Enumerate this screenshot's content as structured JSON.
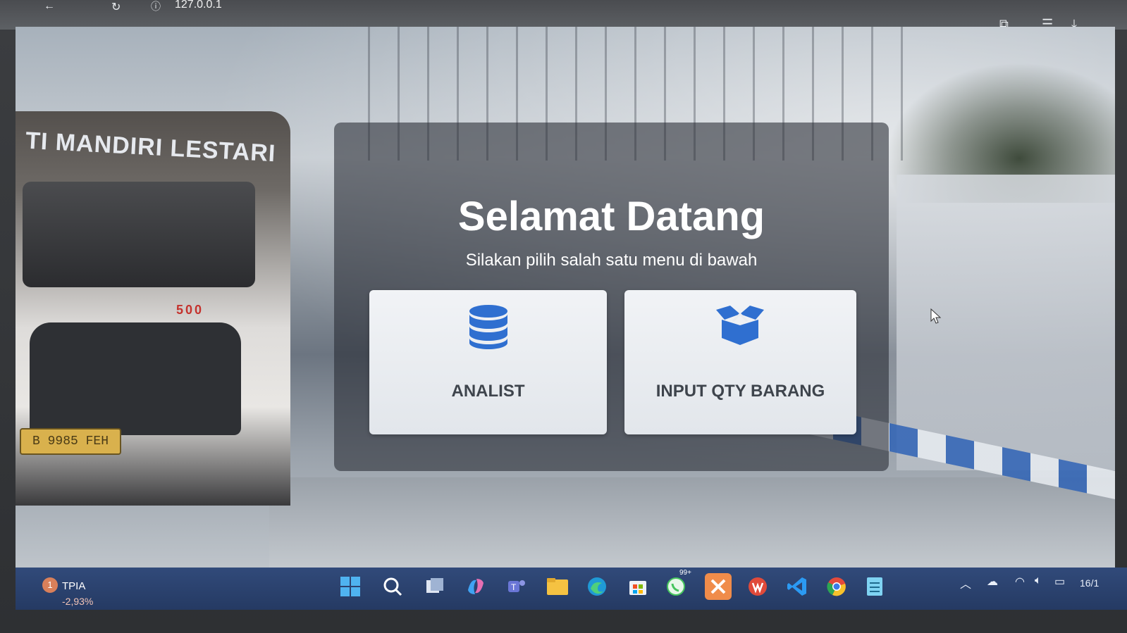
{
  "browser": {
    "url": "127.0.0.1",
    "back_icon": "arrow-left-icon",
    "reload_icon": "reload-icon",
    "info_icon": "info-icon"
  },
  "background": {
    "truck_text": "TI MANDIRI LESTARI",
    "truck_model": "500",
    "plate": "B 9985 FEH"
  },
  "welcome": {
    "title": "Selamat Datang",
    "subtitle": "Silakan pilih salah satu menu di bawah"
  },
  "menu": {
    "analist": {
      "label": "ANALIST",
      "icon": "database-icon",
      "color": "#2f6fd0"
    },
    "input_qty": {
      "label": "INPUT QTY BARANG",
      "icon": "box-open-icon",
      "color": "#2f6fd0"
    }
  },
  "taskbar": {
    "widget_badge": "1",
    "widget_name": "TPIA",
    "widget_change": "-2,93%",
    "date": "16/1",
    "whatsapp_badge": "99+"
  }
}
